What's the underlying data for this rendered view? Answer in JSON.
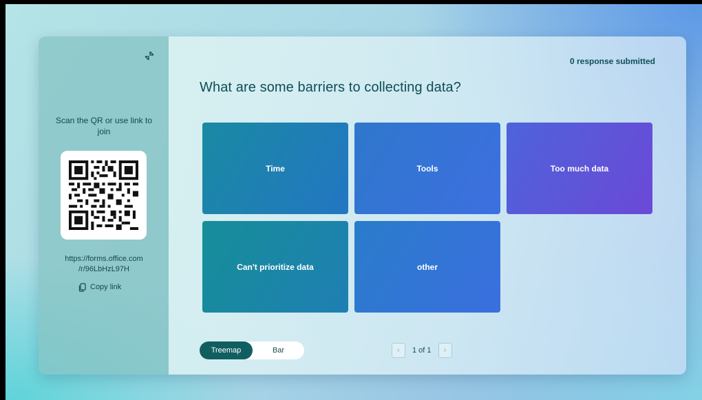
{
  "sidebar": {
    "scan_text": "Scan the QR or use link to join",
    "link_line1": "https://forms.office.com",
    "link_line2": "/r/96LbHzL97H",
    "copy_label": "Copy link"
  },
  "header": {
    "responses": "0 response submitted",
    "question": "What are some barriers to collecting data?"
  },
  "tiles": [
    {
      "label": "Time"
    },
    {
      "label": "Tools"
    },
    {
      "label": "Too much data"
    },
    {
      "label": "Can't prioritize data"
    },
    {
      "label": "other"
    }
  ],
  "view_toggle": {
    "treemap": "Treemap",
    "bar": "Bar",
    "selected": "Treemap"
  },
  "pager": {
    "label": "1 of 1",
    "prev_glyph": "‹",
    "next_glyph": "›"
  },
  "colors": {
    "accent_dark": "#115e61",
    "title_text": "#0f4d55"
  }
}
